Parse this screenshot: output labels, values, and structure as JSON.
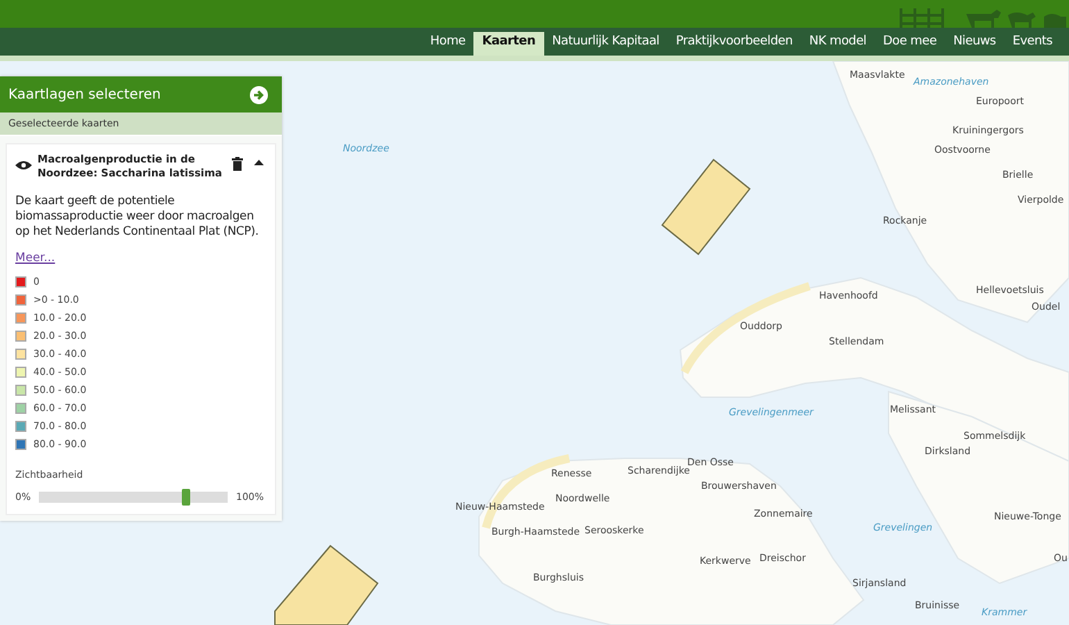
{
  "nav": [
    {
      "label": "Home",
      "selected": false
    },
    {
      "label": "Kaarten",
      "selected": true
    },
    {
      "label": "Natuurlijk Kapitaal",
      "selected": false
    },
    {
      "label": "Praktijkvoorbeelden",
      "selected": false
    },
    {
      "label": "NK model",
      "selected": false
    },
    {
      "label": "Doe mee",
      "selected": false
    },
    {
      "label": "Nieuws",
      "selected": false
    },
    {
      "label": "Events",
      "selected": false
    }
  ],
  "panel": {
    "title": "Kaartlagen selecteren",
    "subtitle": "Geselecteerde kaarten",
    "layer": {
      "title": "Macroalgenproductie in de Noordzee: Saccharina latissima",
      "visible": true,
      "expanded": true,
      "description": "De kaart geeft de potentiele biomassaproductie weer door macroalgen op het Nederlands Continentaal Plat (NCP).",
      "link": "Meer...",
      "legend": [
        {
          "label": "0",
          "color": "#e31a1c"
        },
        {
          "label": ">0 - 10.0",
          "color": "#f0643c"
        },
        {
          "label": "10.0 - 20.0",
          "color": "#f7965a"
        },
        {
          "label": "20.0 - 30.0",
          "color": "#fbbf72"
        },
        {
          "label": "30.0 - 40.0",
          "color": "#fde3a0"
        },
        {
          "label": "40.0 - 50.0",
          "color": "#eef5b0"
        },
        {
          "label": "50.0 - 60.0",
          "color": "#c9e6a8"
        },
        {
          "label": "60.0 - 70.0",
          "color": "#9ed2a5"
        },
        {
          "label": "70.0 - 80.0",
          "color": "#5aa9b5"
        },
        {
          "label": "80.0 - 90.0",
          "color": "#2f75b5"
        }
      ],
      "opacity": {
        "label": "Zichtbaarheid",
        "min": "0%",
        "max": "100%",
        "level": 0.78
      }
    }
  },
  "map": {
    "labels": [
      {
        "text": "Noordzee",
        "kind": "water"
      },
      {
        "text": "Maasvlakte",
        "kind": "place"
      },
      {
        "text": "Amazonehaven",
        "kind": "water"
      },
      {
        "text": "Europoort",
        "kind": "place"
      },
      {
        "text": "Kruiningergors",
        "kind": "place"
      },
      {
        "text": "Oostvoorne",
        "kind": "place"
      },
      {
        "text": "Brielle",
        "kind": "place"
      },
      {
        "text": "Vierpolde",
        "kind": "place"
      },
      {
        "text": "Rockanje",
        "kind": "place"
      },
      {
        "text": "Havenhoofd",
        "kind": "place"
      },
      {
        "text": "Hellevoetsluis",
        "kind": "place"
      },
      {
        "text": "Oudel",
        "kind": "place"
      },
      {
        "text": "Ouddorp",
        "kind": "place"
      },
      {
        "text": "Stellendam",
        "kind": "place"
      },
      {
        "text": "Grevelingenmeer",
        "kind": "water"
      },
      {
        "text": "Melissant",
        "kind": "place"
      },
      {
        "text": "Sommelsdijk",
        "kind": "place"
      },
      {
        "text": "Dirksland",
        "kind": "place"
      },
      {
        "text": "Den Osse",
        "kind": "place"
      },
      {
        "text": "Renesse",
        "kind": "place"
      },
      {
        "text": "Scharendijke",
        "kind": "place"
      },
      {
        "text": "Brouwershaven",
        "kind": "place"
      },
      {
        "text": "Noordwelle",
        "kind": "place"
      },
      {
        "text": "Nieuw-Haamstede",
        "kind": "place"
      },
      {
        "text": "Zonnemaire",
        "kind": "place"
      },
      {
        "text": "Nieuwe-Tonge",
        "kind": "place"
      },
      {
        "text": "Grevelingen",
        "kind": "water"
      },
      {
        "text": "Burgh-Haamstede",
        "kind": "place"
      },
      {
        "text": "Serooskerke",
        "kind": "place"
      },
      {
        "text": "Kerkwerve",
        "kind": "place"
      },
      {
        "text": "Dreischor",
        "kind": "place"
      },
      {
        "text": "Ou",
        "kind": "place"
      },
      {
        "text": "Sirjansland",
        "kind": "place"
      },
      {
        "text": "Burghsluis",
        "kind": "place"
      },
      {
        "text": "Bruinisse",
        "kind": "place"
      },
      {
        "text": "Krammer",
        "kind": "water"
      }
    ]
  }
}
